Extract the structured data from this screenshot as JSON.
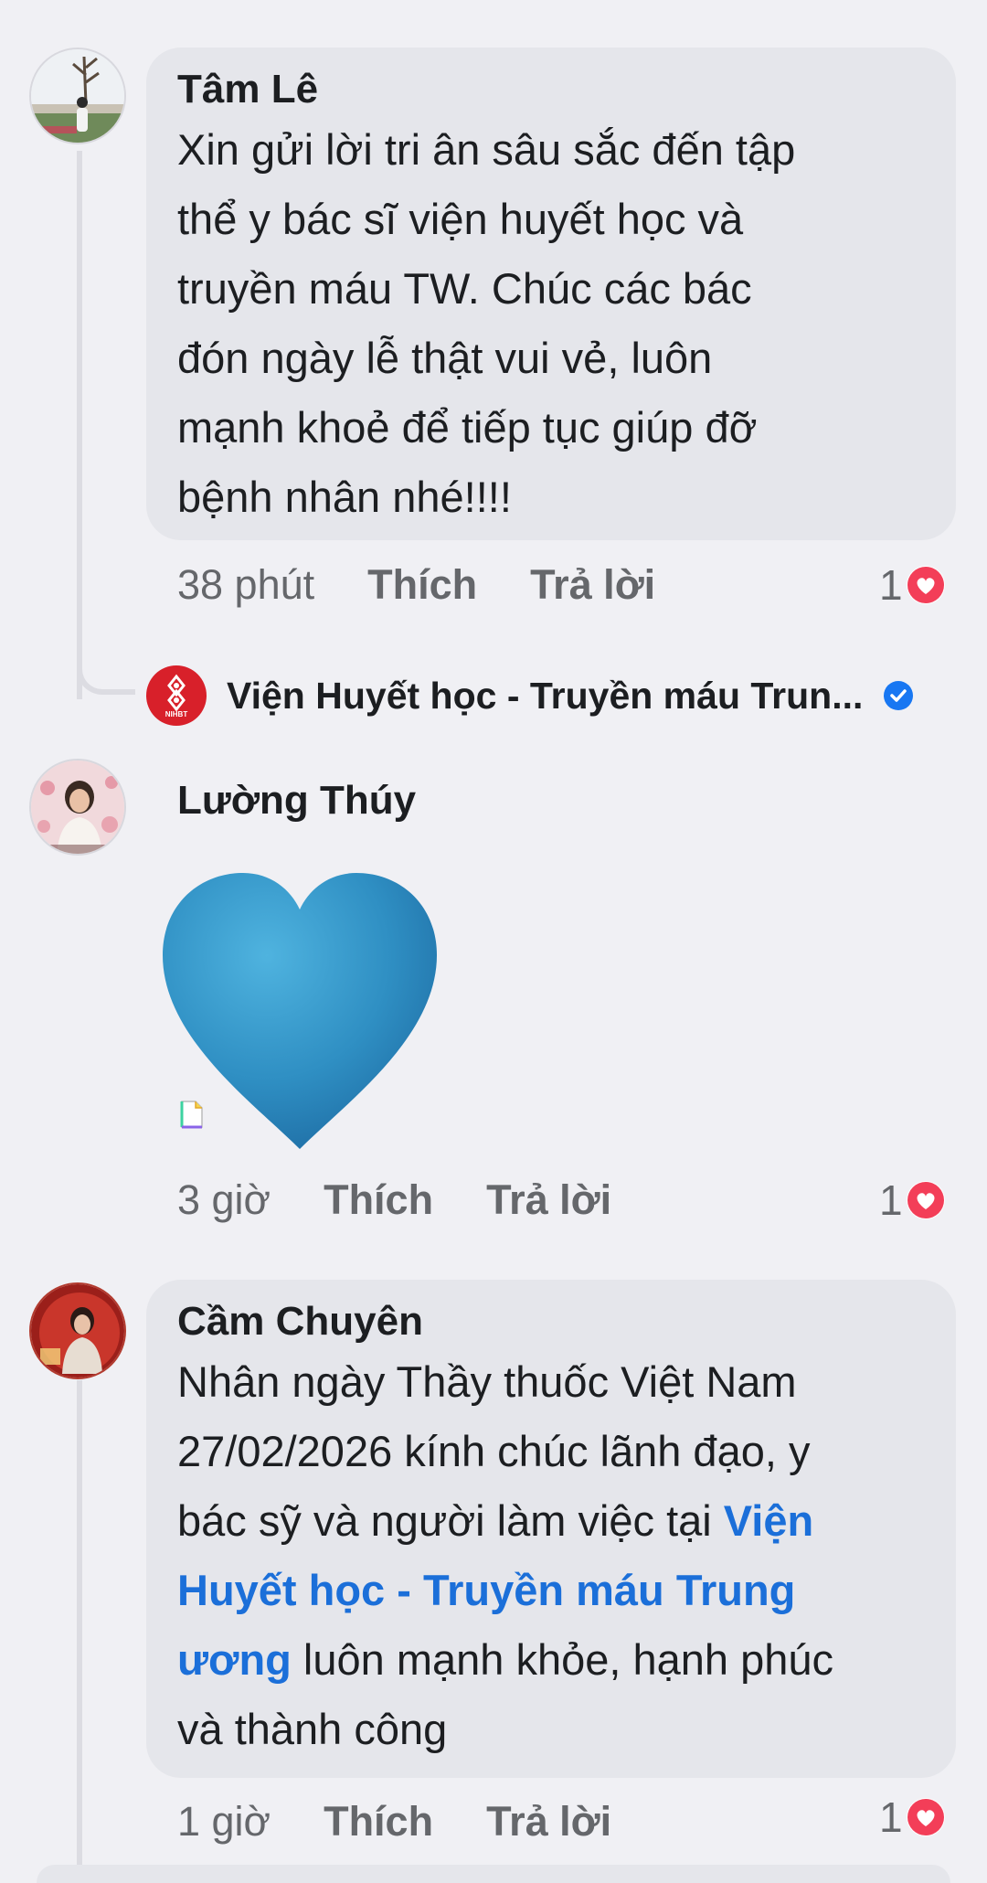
{
  "comments": [
    {
      "author": "Tâm Lê",
      "text_lines": [
        "Xin gửi lời tri ân sâu sắc đến tập",
        "thể y bác sĩ viện huyết học và",
        "truyền máu TW. Chúc các bác",
        "đón ngày lễ thật vui vẻ, luôn",
        "mạnh khoẻ để tiếp tục giúp đỡ",
        "bệnh nhân nhé!!!!"
      ],
      "time": "38 phút",
      "like_label": "Thích",
      "reply_label": "Trả lời",
      "reaction_count": "1"
    },
    {
      "author": "Lường Thúy",
      "sticker": "blue-heart",
      "time": "3 giờ",
      "like_label": "Thích",
      "reply_label": "Trả lời",
      "reaction_count": "1"
    },
    {
      "author": "Cầm Chuyên",
      "line1": "Nhân ngày Thầy thuốc Việt Nam",
      "line2": "27/02/2026 kính chúc lãnh đạo, y",
      "line3_plain": "bác sỹ và người làm việc tại ",
      "line3_mention": "Viện",
      "line4_mention": "Huyết học - Truyền máu Trung",
      "line5_mention": "ương",
      "line5_plain": " luôn mạnh khỏe, hạnh phúc",
      "line6": "và thành công",
      "time": "1 giờ",
      "like_label": "Thích",
      "reply_label": "Trả lời",
      "reaction_count": "1"
    }
  ],
  "reply_preview": {
    "page_name": "Viện Huyết học - Truyền máu Trun...",
    "logo_text": "NIHBT",
    "verified": true
  },
  "colors": {
    "background": "#f0f0f4",
    "bubble": "#e5e6eb",
    "mention": "#1b6fd9",
    "love_reaction": "#f33e58",
    "verified_badge": "#1877f2"
  }
}
